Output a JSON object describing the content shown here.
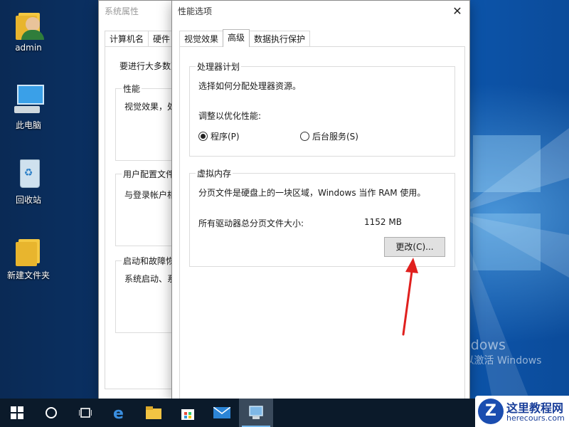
{
  "desktop": {
    "icons": [
      {
        "label": "admin"
      },
      {
        "label": "此电脑"
      },
      {
        "label": "回收站"
      },
      {
        "label": "新建文件夹"
      }
    ],
    "watermark": {
      "line1": "激活 Windows",
      "line2": "转到“设置”以激活 Windows",
      "line3": "。"
    }
  },
  "sys_props": {
    "title": "系统属性",
    "tabs": [
      "计算机名",
      "硬件"
    ],
    "intro": "要进行大多数更",
    "groups": [
      {
        "title": "性能",
        "text": "视觉效果，处"
      },
      {
        "title": "用户配置文件",
        "text": "与登录帐户相"
      },
      {
        "title": "启动和故障恢",
        "text": "系统启动、系"
      }
    ]
  },
  "perf": {
    "title": "性能选项",
    "close_glyph": "✕",
    "tabs": [
      "视觉效果",
      "高级",
      "数据执行保护"
    ],
    "active_tab": "高级",
    "scheduling": {
      "title": "处理器计划",
      "desc": "选择如何分配处理器资源。",
      "adjust_label": "调整以优化性能:",
      "options": [
        {
          "label": "程序(P)",
          "checked": true
        },
        {
          "label": "后台服务(S)",
          "checked": false
        }
      ]
    },
    "vm": {
      "title": "虚拟内存",
      "desc": "分页文件是硬盘上的一块区域，Windows 当作 RAM 使用。",
      "size_label": "所有驱动器总分页文件大小:",
      "size_value": "1152 MB",
      "change_button": "更改(C)..."
    }
  },
  "taskbar": {
    "items": [
      "start-icon",
      "cortana-icon",
      "task-view-icon",
      "edge-icon",
      "file-explorer-icon",
      "store-icon",
      "mail-icon",
      "system-properties-icon"
    ]
  },
  "logo": {
    "cn": "这里教程网",
    "en": "herecours.com"
  },
  "accent_color": "#76b9ed",
  "arrow_color": "#e0201e"
}
